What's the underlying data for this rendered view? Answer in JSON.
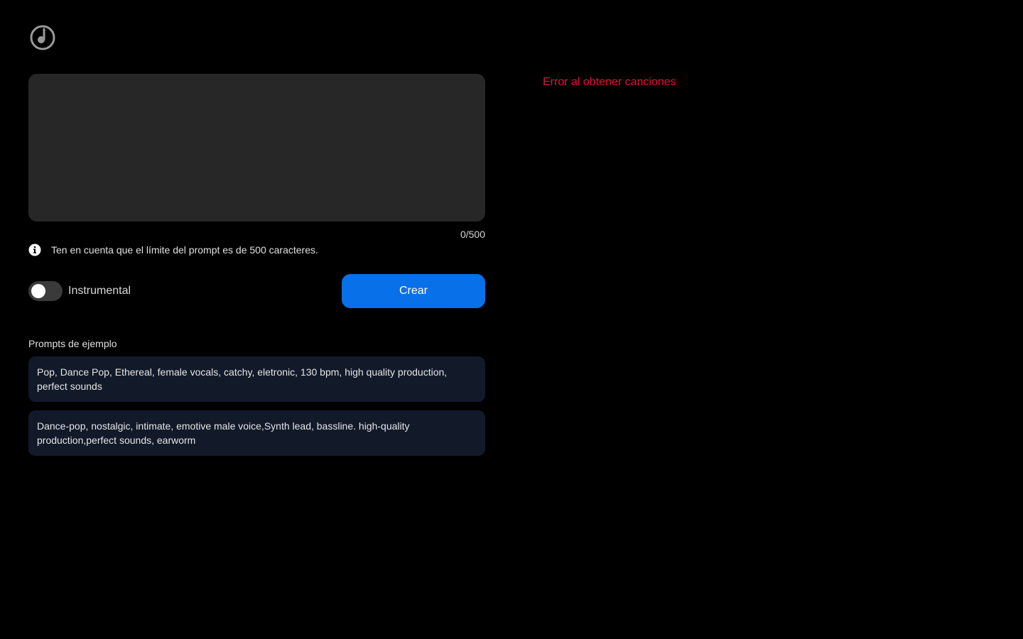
{
  "app": {
    "logo_icon": "music-note-circle-icon"
  },
  "composer": {
    "prompt_value": "",
    "prompt_placeholder": "",
    "char_counter": "0/500",
    "notice_icon": "info-icon",
    "notice_text": "Ten en cuenta que el límite del prompt es de 500 caracteres.",
    "instrumental_label": "Instrumental",
    "instrumental_on": false,
    "create_label": "Crear"
  },
  "examples": {
    "title": "Prompts de ejemplo",
    "items": [
      {
        "text": "Pop, Dance Pop, Ethereal, female vocals, catchy, eletronic, 130 bpm, high quality production, perfect sounds"
      },
      {
        "text": "Dance-pop, nostalgic, intimate, emotive male voice,Synth lead, bassline. high-quality production,perfect sounds, earworm"
      }
    ]
  },
  "songs": {
    "error_text": "Error al obtener canciones"
  },
  "colors": {
    "background": "#000000",
    "input_bg": "#272727",
    "accent": "#0870e8",
    "example_bg": "#121a2a",
    "error": "#e8103a"
  }
}
